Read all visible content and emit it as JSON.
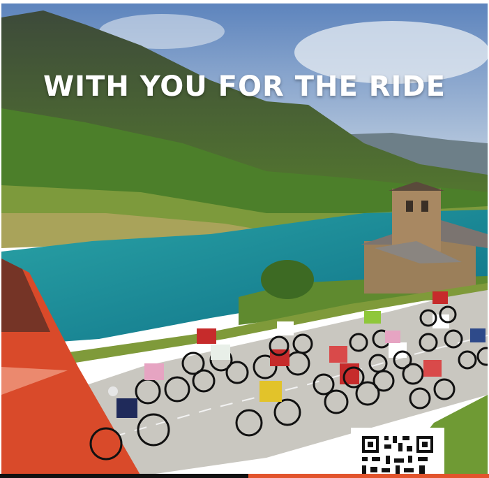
{
  "headline": "WITH YOU FOR THE RIDE",
  "colors": {
    "sky": "#6f93c4",
    "lake": "#1a8f9a",
    "grass": "#4e7a2a",
    "road": "#c9c7c0",
    "accent_red": "#d94a2a",
    "headline": "#ffffff"
  },
  "icons": [
    "qr-code"
  ]
}
